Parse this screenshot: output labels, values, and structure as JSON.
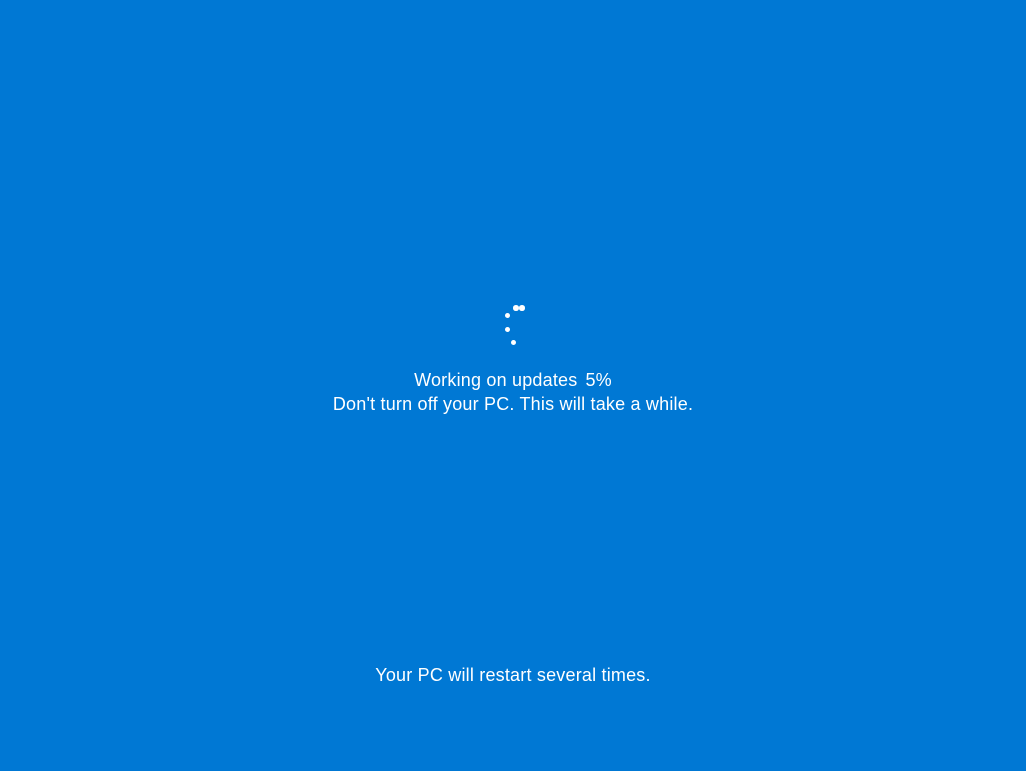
{
  "update": {
    "status_label": "Working on updates",
    "progress_percent": "5%",
    "warning_text": "Don't turn off your PC. This will take a while.",
    "restart_notice": "Your PC will restart several times."
  }
}
